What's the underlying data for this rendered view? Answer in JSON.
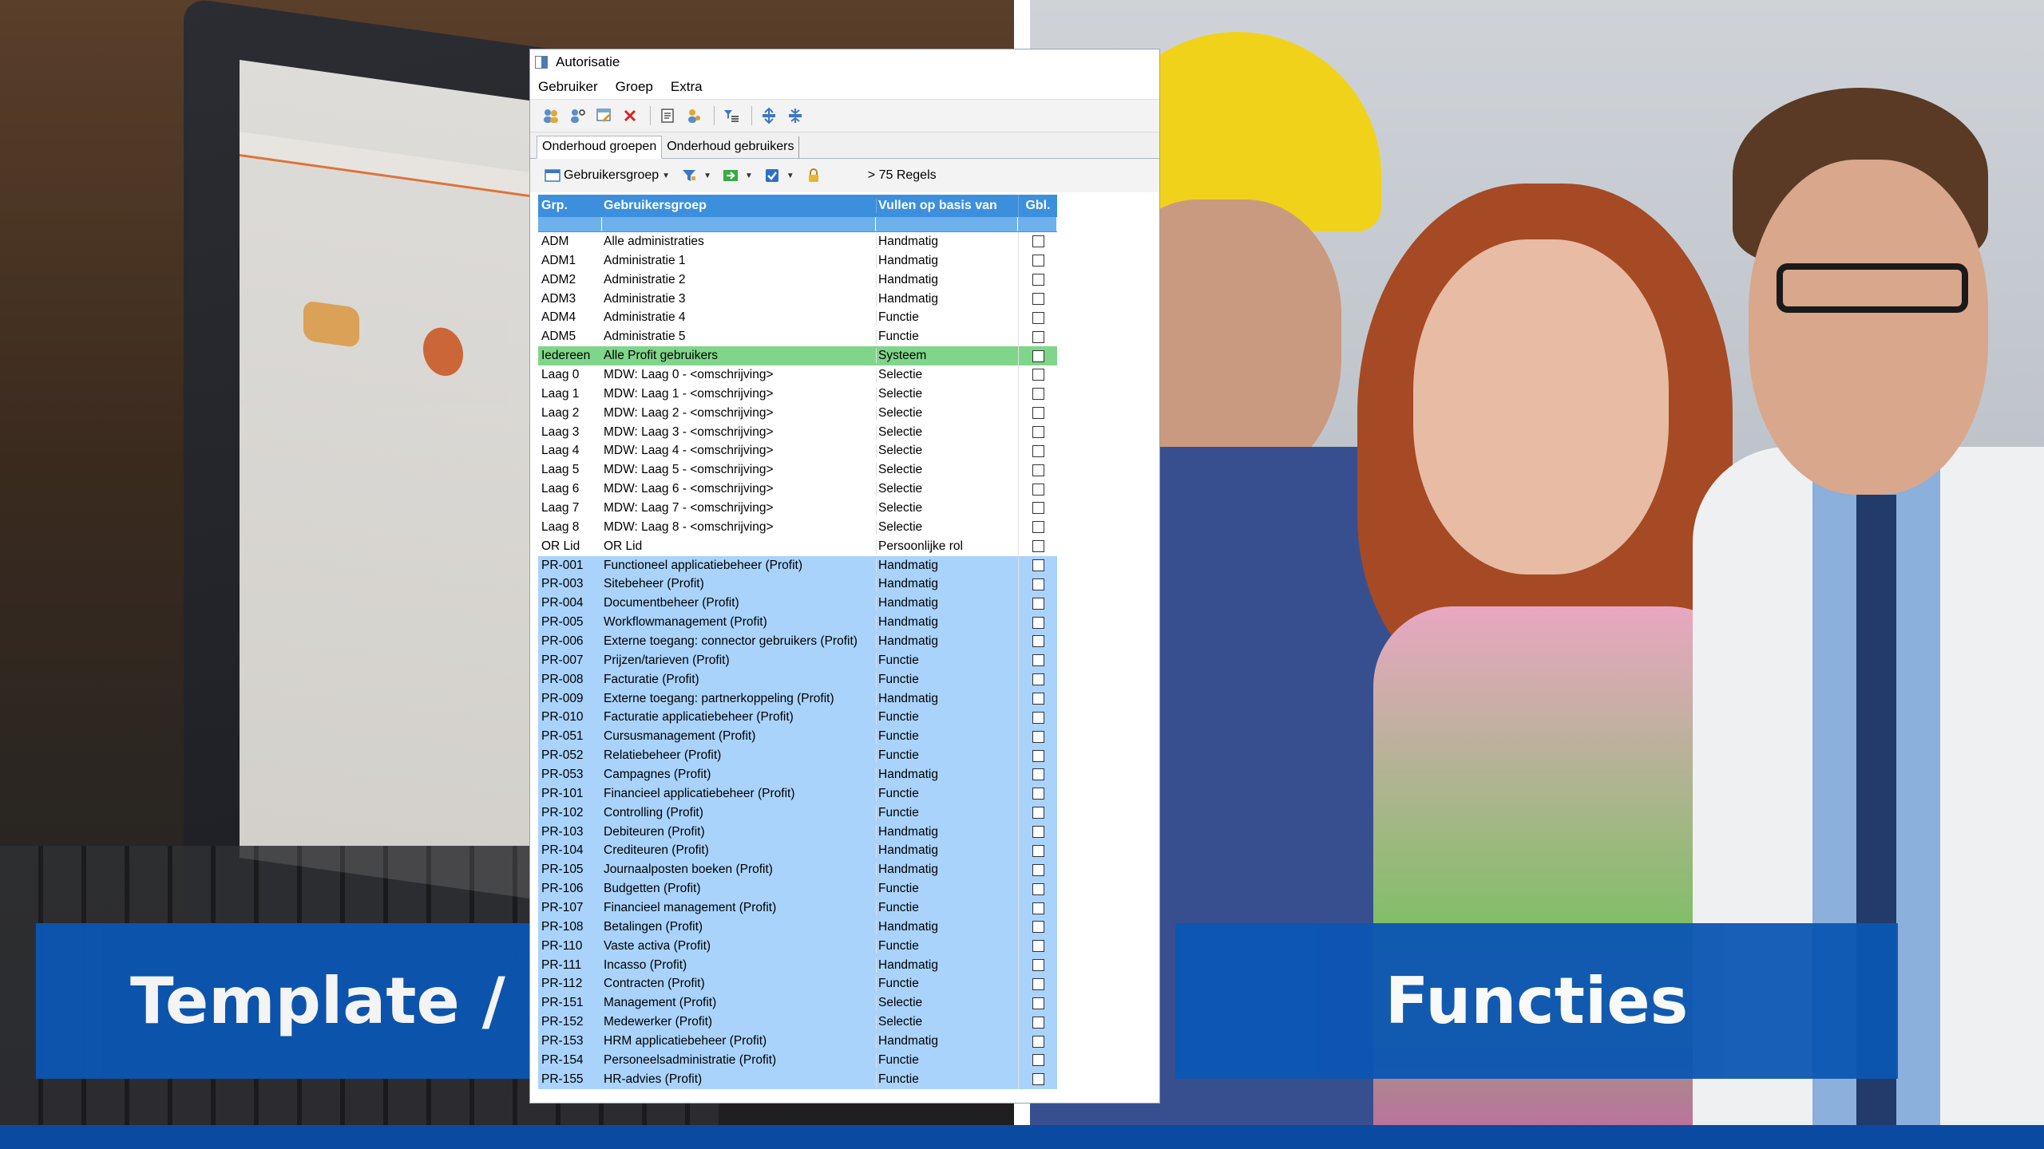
{
  "captions": {
    "left": "Template / bl",
    "right": "Functies"
  },
  "window": {
    "title": "Autorisatie",
    "icon": "window-app-icon"
  },
  "menu": [
    "Gebruiker",
    "Groep",
    "Extra"
  ],
  "tabs": [
    {
      "label": "Onderhoud groepen",
      "active": true
    },
    {
      "label": "Onderhoud gebruikers",
      "active": false
    }
  ],
  "subtoolbar": {
    "group_label": "Gebruikersgroep",
    "count_label": "> 75 Regels"
  },
  "grid": {
    "columns": [
      "Grp.",
      "Gebruikersgroep",
      "Vullen op basis van",
      "Gbl."
    ],
    "rows": [
      {
        "grp": "ADM",
        "name": "Alle administraties",
        "vullen": "Handmatig",
        "style": "normal"
      },
      {
        "grp": "ADM1",
        "name": "Administratie 1",
        "vullen": "Handmatig",
        "style": "normal"
      },
      {
        "grp": "ADM2",
        "name": "Administratie 2",
        "vullen": "Handmatig",
        "style": "normal"
      },
      {
        "grp": "ADM3",
        "name": "Administratie 3",
        "vullen": "Handmatig",
        "style": "normal"
      },
      {
        "grp": "ADM4",
        "name": "Administratie 4",
        "vullen": "Functie",
        "style": "normal"
      },
      {
        "grp": "ADM5",
        "name": "Administratie 5",
        "vullen": "Functie",
        "style": "normal"
      },
      {
        "grp": "Iedereen",
        "name": "Alle Profit gebruikers",
        "vullen": "Systeem",
        "style": "green"
      },
      {
        "grp": "Laag 0",
        "name": "MDW: Laag 0 - <omschrijving>",
        "vullen": "Selectie",
        "style": "normal"
      },
      {
        "grp": "Laag 1",
        "name": "MDW: Laag 1 - <omschrijving>",
        "vullen": "Selectie",
        "style": "normal"
      },
      {
        "grp": "Laag 2",
        "name": "MDW: Laag 2 - <omschrijving>",
        "vullen": "Selectie",
        "style": "normal"
      },
      {
        "grp": "Laag 3",
        "name": "MDW: Laag 3 - <omschrijving>",
        "vullen": "Selectie",
        "style": "normal"
      },
      {
        "grp": "Laag 4",
        "name": "MDW: Laag 4 - <omschrijving>",
        "vullen": "Selectie",
        "style": "normal"
      },
      {
        "grp": "Laag 5",
        "name": "MDW: Laag 5 - <omschrijving>",
        "vullen": "Selectie",
        "style": "normal"
      },
      {
        "grp": "Laag 6",
        "name": "MDW: Laag 6 - <omschrijving>",
        "vullen": "Selectie",
        "style": "normal"
      },
      {
        "grp": "Laag 7",
        "name": "MDW: Laag 7 - <omschrijving>",
        "vullen": "Selectie",
        "style": "normal"
      },
      {
        "grp": "Laag 8",
        "name": "MDW: Laag 8 - <omschrijving>",
        "vullen": "Selectie",
        "style": "normal"
      },
      {
        "grp": "OR Lid",
        "name": "OR Lid",
        "vullen": "Persoonlijke rol",
        "style": "normal"
      },
      {
        "grp": "PR-001",
        "name": "Functioneel applicatiebeheer (Profit)",
        "vullen": "Handmatig",
        "style": "blue"
      },
      {
        "grp": "PR-003",
        "name": "Sitebeheer (Profit)",
        "vullen": "Handmatig",
        "style": "blue"
      },
      {
        "grp": "PR-004",
        "name": "Documentbeheer (Profit)",
        "vullen": "Handmatig",
        "style": "blue"
      },
      {
        "grp": "PR-005",
        "name": "Workflowmanagement (Profit)",
        "vullen": "Handmatig",
        "style": "blue"
      },
      {
        "grp": "PR-006",
        "name": "Externe toegang: connector gebruikers (Profit)",
        "vullen": "Handmatig",
        "style": "blue"
      },
      {
        "grp": "PR-007",
        "name": "Prijzen/tarieven (Profit)",
        "vullen": "Functie",
        "style": "blue"
      },
      {
        "grp": "PR-008",
        "name": "Facturatie (Profit)",
        "vullen": "Functie",
        "style": "blue"
      },
      {
        "grp": "PR-009",
        "name": "Externe toegang: partnerkoppeling (Profit)",
        "vullen": "Handmatig",
        "style": "blue"
      },
      {
        "grp": "PR-010",
        "name": "Facturatie applicatiebeheer (Profit)",
        "vullen": "Functie",
        "style": "blue"
      },
      {
        "grp": "PR-051",
        "name": "Cursusmanagement (Profit)",
        "vullen": "Functie",
        "style": "blue"
      },
      {
        "grp": "PR-052",
        "name": "Relatiebeheer (Profit)",
        "vullen": "Functie",
        "style": "blue"
      },
      {
        "grp": "PR-053",
        "name": "Campagnes (Profit)",
        "vullen": "Handmatig",
        "style": "blue"
      },
      {
        "grp": "PR-101",
        "name": "Financieel applicatiebeheer (Profit)",
        "vullen": "Functie",
        "style": "blue"
      },
      {
        "grp": "PR-102",
        "name": "Controlling (Profit)",
        "vullen": "Functie",
        "style": "blue"
      },
      {
        "grp": "PR-103",
        "name": "Debiteuren (Profit)",
        "vullen": "Handmatig",
        "style": "blue"
      },
      {
        "grp": "PR-104",
        "name": "Crediteuren (Profit)",
        "vullen": "Handmatig",
        "style": "blue"
      },
      {
        "grp": "PR-105",
        "name": "Journaalposten boeken (Profit)",
        "vullen": "Handmatig",
        "style": "blue"
      },
      {
        "grp": "PR-106",
        "name": "Budgetten (Profit)",
        "vullen": "Functie",
        "style": "blue"
      },
      {
        "grp": "PR-107",
        "name": "Financieel management (Profit)",
        "vullen": "Functie",
        "style": "blue"
      },
      {
        "grp": "PR-108",
        "name": "Betalingen (Profit)",
        "vullen": "Handmatig",
        "style": "blue"
      },
      {
        "grp": "PR-110",
        "name": "Vaste activa (Profit)",
        "vullen": "Functie",
        "style": "blue"
      },
      {
        "grp": "PR-111",
        "name": "Incasso (Profit)",
        "vullen": "Handmatig",
        "style": "blue"
      },
      {
        "grp": "PR-112",
        "name": "Contracten (Profit)",
        "vullen": "Functie",
        "style": "blue"
      },
      {
        "grp": "PR-151",
        "name": "Management (Profit)",
        "vullen": "Selectie",
        "style": "blue"
      },
      {
        "grp": "PR-152",
        "name": "Medewerker (Profit)",
        "vullen": "Selectie",
        "style": "blue"
      },
      {
        "grp": "PR-153",
        "name": "HRM applicatiebeheer (Profit)",
        "vullen": "Handmatig",
        "style": "blue"
      },
      {
        "grp": "PR-154",
        "name": "Personeelsadministratie (Profit)",
        "vullen": "Functie",
        "style": "blue"
      },
      {
        "grp": "PR-155",
        "name": "HR-advies (Profit)",
        "vullen": "Functie",
        "style": "blue"
      }
    ]
  },
  "colors": {
    "caption_bg": "#0b56b3",
    "grid_header": "#3c8fdd",
    "row_blue": "#a9d3fb",
    "row_green": "#7fd68a"
  }
}
